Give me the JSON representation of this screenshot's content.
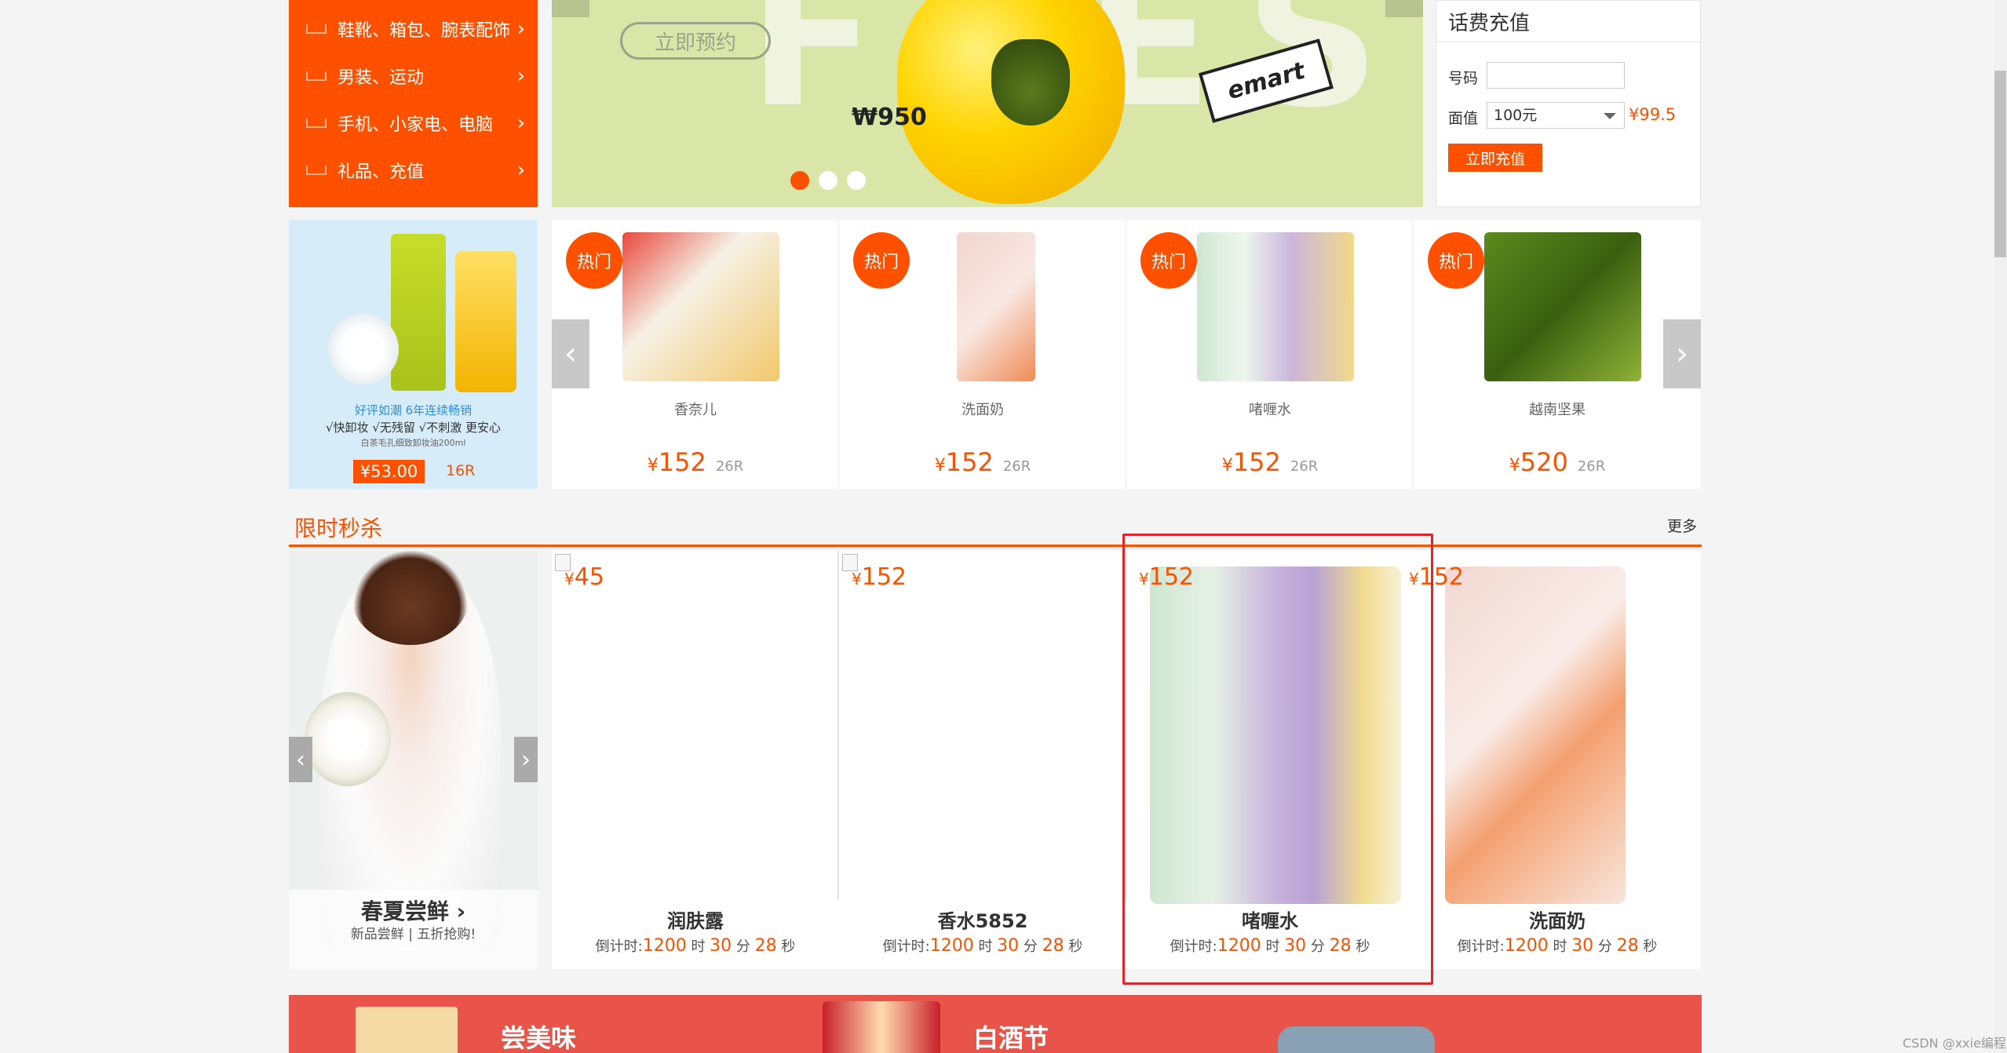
{
  "category_menu": [
    {
      "label": "鞋靴、箱包、腕表配饰",
      "icon": "shoe-icon"
    },
    {
      "label": "男装、运动",
      "icon": "clothes-icon"
    },
    {
      "label": "手机、小家电、电脑",
      "icon": "phone-icon"
    },
    {
      "label": "礼品、充值",
      "icon": "gift-icon"
    }
  ],
  "banner": {
    "bg_text": "FRESH",
    "reserve_button": "立即预约",
    "price_tag": "₩950",
    "brand": "emart",
    "dots": 3,
    "active_dot": 0,
    "accent": "#ff5000"
  },
  "recharge": {
    "title": "话费充值",
    "phone_label": "号码",
    "phone_value": "",
    "amount_label": "面值",
    "amount_selected": "100元",
    "price": "¥99.5",
    "submit_button": "立即充值"
  },
  "promo": {
    "line1": "好评如潮 6年连续畅销",
    "line2": "√快卸妆 √无残留 √不刺激 更安心",
    "line3": "白茶毛孔细致卸妆油200ml",
    "price": "¥53.00",
    "unit": "16R"
  },
  "hot_products": {
    "badge": "热门",
    "items": [
      {
        "name": "香奈儿",
        "price": "152",
        "unit": "26R"
      },
      {
        "name": "洗面奶",
        "price": "152",
        "unit": "26R"
      },
      {
        "name": "啫喱水",
        "price": "152",
        "unit": "26R"
      },
      {
        "name": "越南坚果",
        "price": "520",
        "unit": "26R"
      }
    ]
  },
  "flash_sale": {
    "title": "限时秒杀",
    "more": "更多",
    "banner_title": "春夏尝鲜",
    "banner_arrow": "›",
    "banner_sub": "新品尝鲜 | 五折抢购!",
    "countdown_prefix": "倒计时:",
    "h_unit": "时",
    "m_unit": "分",
    "s_unit": "秒",
    "items": [
      {
        "name": "润肤露",
        "price": "45",
        "hours": "1200",
        "minutes": "30",
        "seconds": "28"
      },
      {
        "name": "香水5852",
        "price": "152",
        "hours": "1200",
        "minutes": "30",
        "seconds": "28"
      },
      {
        "name": "啫喱水",
        "price": "152",
        "hours": "1200",
        "minutes": "30",
        "seconds": "28"
      },
      {
        "name": "洗面奶",
        "price": "152",
        "hours": "1200",
        "minutes": "30",
        "seconds": "28"
      }
    ]
  },
  "bottom_banner": {
    "text1": "尝美味",
    "text2": "白酒节"
  },
  "currency": "¥",
  "watermark": "CSDN @xxie编程"
}
